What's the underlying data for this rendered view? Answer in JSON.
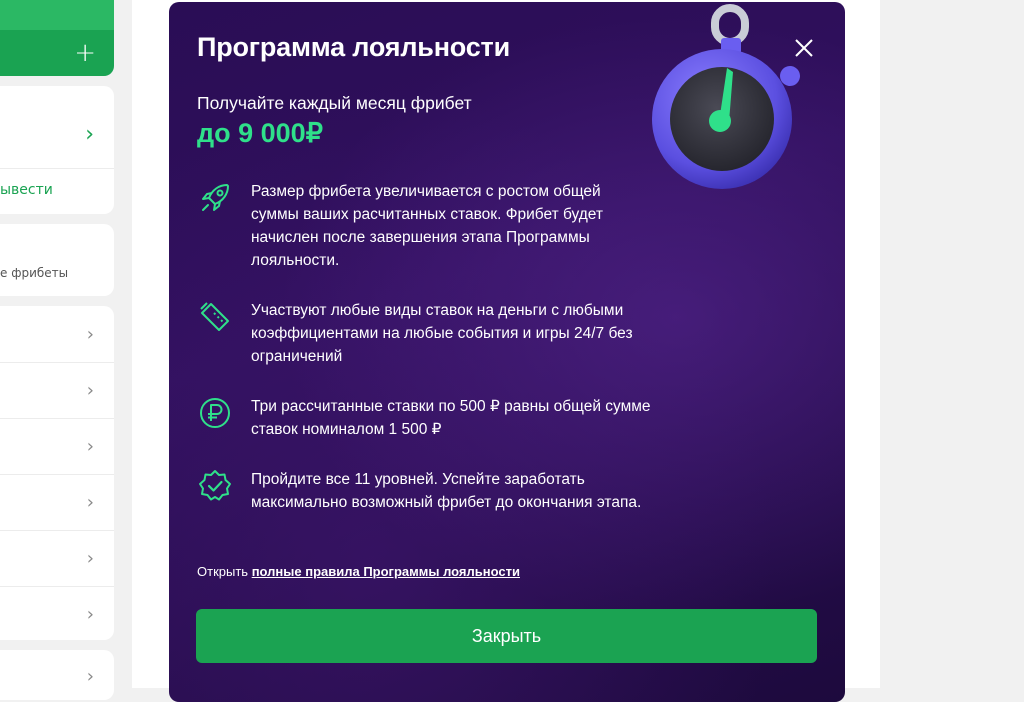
{
  "sidebar": {
    "withdraw_text": "ывести",
    "freebets_text": "е фрибеты",
    "plus_symbol": "+",
    "chevron": "›"
  },
  "modal": {
    "title": "Программа лояльности",
    "subtitle": "Получайте каждый месяц фрибет",
    "amount": "до 9 000₽",
    "features": [
      {
        "icon": "rocket-icon",
        "text": "Размер фрибета увеличивается с ростом общей суммы ваших расчитанных ставок. Фрибет будет начислен после завершения этапа Программы лояльности."
      },
      {
        "icon": "ticket-icon",
        "text": "Участвуют любые виды ставок на деньги с любыми коэффициентами на любые события и игры 24/7 без ограничений"
      },
      {
        "icon": "ruble-coin-icon",
        "text": "Три рассчитанные ставки по 500 ₽ равны общей сумме ставок номиналом 1 500 ₽"
      },
      {
        "icon": "verified-badge-icon",
        "text": "Пройдите все 11 уровней. Успейте заработать максимально возможный фрибет до окончания этапа."
      }
    ],
    "rules_prefix": "Открыть",
    "rules_link": "полные правила Программы лояльности",
    "close_button": "Закрыть"
  },
  "colors": {
    "accent_green": "#1ba352",
    "amount_green": "#2fe08a",
    "modal_bg": "#2a0d55"
  }
}
